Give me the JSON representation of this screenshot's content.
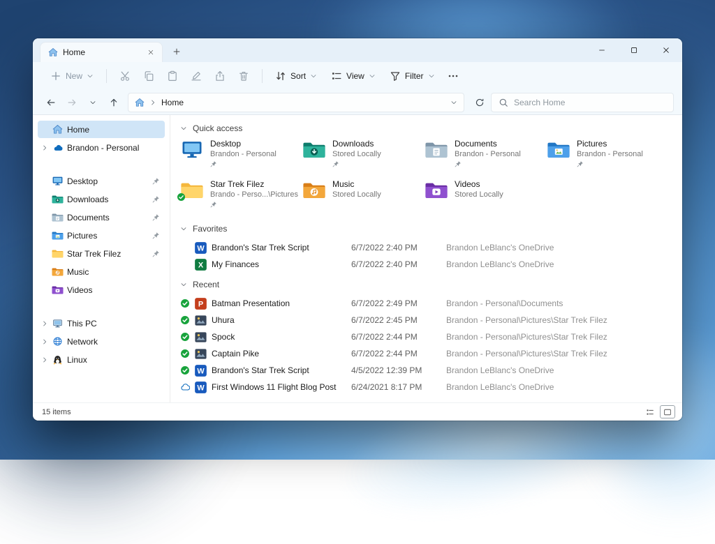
{
  "tab": {
    "title": "Home"
  },
  "toolbar": {
    "new_label": "New",
    "sort_label": "Sort",
    "view_label": "View",
    "filter_label": "Filter",
    "icon_buttons": [
      {
        "icon": "cut"
      },
      {
        "icon": "copy"
      },
      {
        "icon": "paste"
      },
      {
        "icon": "rename"
      },
      {
        "icon": "share"
      },
      {
        "icon": "delete"
      }
    ]
  },
  "address": {
    "root": "Home",
    "search_placeholder": "Search Home"
  },
  "sidebar": {
    "items": [
      {
        "label": "Home",
        "icon": "home",
        "selected": true
      },
      {
        "label": "Brandon - Personal",
        "icon": "onedrive",
        "chevron": true
      },
      {
        "label": "Desktop",
        "icon": "f-desktop",
        "pinned": true,
        "gap": true
      },
      {
        "label": "Downloads",
        "icon": "f-downloads",
        "pinned": true
      },
      {
        "label": "Documents",
        "icon": "f-documents",
        "pinned": true
      },
      {
        "label": "Pictures",
        "icon": "f-pictures",
        "pinned": true
      },
      {
        "label": "Star Trek Filez",
        "icon": "f-folder",
        "pinned": true
      },
      {
        "label": "Music",
        "icon": "f-music"
      },
      {
        "label": "Videos",
        "icon": "f-videos"
      },
      {
        "label": "This PC",
        "icon": "pc",
        "chevron": true,
        "gap": true
      },
      {
        "label": "Network",
        "icon": "network",
        "chevron": true
      },
      {
        "label": "Linux",
        "icon": "linux",
        "chevron": true
      }
    ]
  },
  "quick_access": {
    "title": "Quick access",
    "tiles": [
      {
        "name": "Desktop",
        "sub": "Brandon - Personal",
        "icon": "f-desktop",
        "pinned": true
      },
      {
        "name": "Downloads",
        "sub": "Stored Locally",
        "icon": "f-downloads",
        "pinned": true
      },
      {
        "name": "Documents",
        "sub": "Brandon - Personal",
        "icon": "f-documents",
        "pinned": true
      },
      {
        "name": "Pictures",
        "sub": "Brandon - Personal",
        "icon": "f-pictures",
        "pinned": true
      },
      {
        "name": "Star Trek Filez",
        "sub": "Brando - Perso...\\Pictures",
        "icon": "f-folder",
        "pinned": true,
        "synced": true
      },
      {
        "name": "Music",
        "sub": "Stored Locally",
        "icon": "f-music"
      },
      {
        "name": "Videos",
        "sub": "Stored Locally",
        "icon": "f-videos"
      }
    ]
  },
  "favorites": {
    "title": "Favorites",
    "rows": [
      {
        "name": "Brandon's Star Trek Script",
        "icon": "word",
        "date": "6/7/2022 2:40 PM",
        "location": "Brandon LeBlanc's OneDrive"
      },
      {
        "name": "My Finances",
        "icon": "excel",
        "date": "6/7/2022 2:40 PM",
        "location": "Brandon LeBlanc's OneDrive"
      }
    ]
  },
  "recent": {
    "title": "Recent",
    "rows": [
      {
        "name": "Batman Presentation",
        "icon": "ppt",
        "status": "check",
        "date": "6/7/2022 2:49 PM",
        "location": "Brandon - Personal\\Documents"
      },
      {
        "name": "Uhura",
        "icon": "photo",
        "status": "check",
        "date": "6/7/2022 2:45 PM",
        "location": "Brandon - Personal\\Pictures\\Star Trek Filez"
      },
      {
        "name": "Spock",
        "icon": "photo",
        "status": "check",
        "date": "6/7/2022 2:44 PM",
        "location": "Brandon - Personal\\Pictures\\Star Trek Filez"
      },
      {
        "name": "Captain Pike",
        "icon": "photo",
        "status": "check",
        "date": "6/7/2022 2:44 PM",
        "location": "Brandon - Personal\\Pictures\\Star Trek Filez"
      },
      {
        "name": "Brandon's Star Trek Script",
        "icon": "word",
        "status": "check",
        "date": "4/5/2022 12:39 PM",
        "location": "Brandon LeBlanc's OneDrive"
      },
      {
        "name": "First Windows 11 Flight Blog Post",
        "icon": "word",
        "status": "cloud",
        "date": "6/24/2021 8:17 PM",
        "location": "Brandon LeBlanc's OneDrive"
      }
    ]
  },
  "statusbar": {
    "count": "15 items"
  }
}
